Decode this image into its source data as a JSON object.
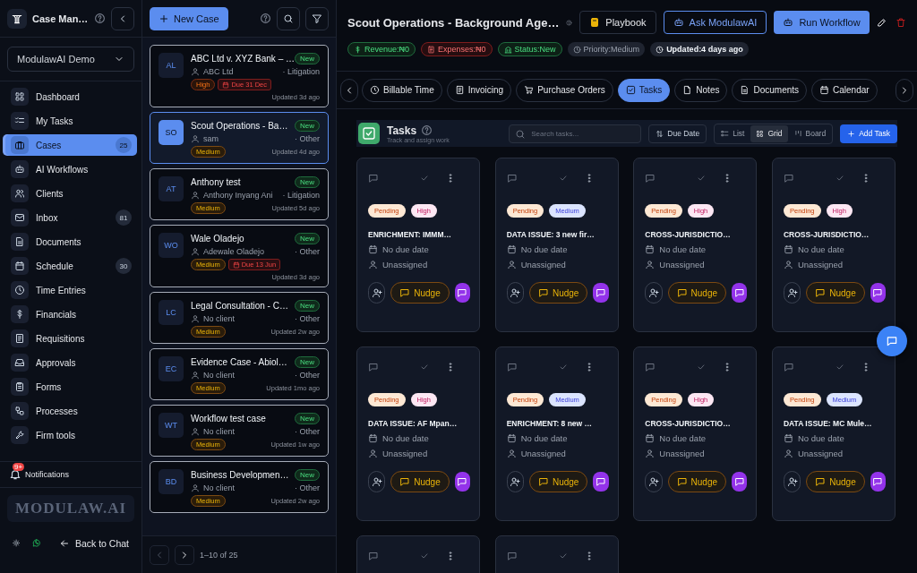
{
  "sidebar": {
    "title": "Case Man…",
    "workspace": "ModulawAI Demo",
    "items": [
      {
        "label": "Dashboard",
        "selected": false
      },
      {
        "label": "My Tasks",
        "selected": false
      },
      {
        "label": "Cases",
        "selected": true,
        "badge": "25"
      },
      {
        "label": "AI Workflows",
        "selected": false
      },
      {
        "label": "Clients",
        "selected": false
      },
      {
        "label": "Inbox",
        "selected": false,
        "badge": "81"
      },
      {
        "label": "Documents",
        "selected": false
      },
      {
        "label": "Schedule",
        "selected": false,
        "badge": "30"
      },
      {
        "label": "Time Entries",
        "selected": false
      },
      {
        "label": "Financials",
        "selected": false
      },
      {
        "label": "Requisitions",
        "selected": false
      },
      {
        "label": "Approvals",
        "selected": false
      },
      {
        "label": "Forms",
        "selected": false
      },
      {
        "label": "Processes",
        "selected": false
      },
      {
        "label": "Firm tools",
        "selected": false
      }
    ],
    "notifications": {
      "label": "Notifications",
      "badge": "9+"
    },
    "logo": "MODULAW.AI",
    "back": "Back to Chat"
  },
  "case_list": {
    "new_button": "New Case",
    "cases": [
      {
        "initials": "AL",
        "title": "ABC Ltd v. XYZ Bank – …",
        "status": "New",
        "client": "ABC Ltd",
        "type": "· Litigation",
        "priority": {
          "label": "High",
          "kind": "high"
        },
        "due": "Due 31 Dec",
        "updated": "Updated 3d ago",
        "selected": false
      },
      {
        "initials": "SO",
        "title": "Scout Operations - Ba…",
        "status": "New",
        "client": "sam",
        "type": "· Other",
        "priority": {
          "label": "Medium",
          "kind": "medium"
        },
        "updated": "Updated 4d ago",
        "selected": true
      },
      {
        "initials": "AT",
        "title": "Anthony test",
        "status": "New",
        "client": "Anthony Inyang Ani",
        "type": "· Litigation",
        "priority": {
          "label": "Medium",
          "kind": "medium"
        },
        "updated": "Updated 5d ago",
        "selected": false
      },
      {
        "initials": "WO",
        "title": "Wale Oladejo",
        "status": "New",
        "client": "Adewale Oladejo",
        "type": "· Other",
        "priority": {
          "label": "Medium",
          "kind": "medium"
        },
        "due": "Due 13 Jun",
        "updated": "Updated 3d ago",
        "selected": false
      },
      {
        "initials": "LC",
        "title": "Legal Consultation - C…",
        "status": "New",
        "client": "No client",
        "type": "· Other",
        "priority": {
          "label": "Medium",
          "kind": "medium"
        },
        "updated": "Updated 2w ago",
        "selected": false
      },
      {
        "initials": "EC",
        "title": "Evidence Case - Abiol…",
        "status": "New",
        "client": "No client",
        "type": "· Other",
        "priority": {
          "label": "Medium",
          "kind": "medium"
        },
        "updated": "Updated 1mo ago",
        "selected": false
      },
      {
        "initials": "WT",
        "title": "Workflow test case",
        "status": "New",
        "client": "No client",
        "type": "· Other",
        "priority": {
          "label": "Medium",
          "kind": "medium"
        },
        "updated": "Updated 1w ago",
        "selected": false
      },
      {
        "initials": "BD",
        "title": "Business Developmen…",
        "status": "New",
        "client": "No client",
        "type": "· Other",
        "priority": {
          "label": "Medium",
          "kind": "medium"
        },
        "updated": "Updated 2w ago",
        "selected": false
      }
    ],
    "pagination": "1–10 of 25"
  },
  "case": {
    "title": "Scout Operations - Background Age…",
    "actions": [
      {
        "label": "Playbook",
        "kind": "plain"
      },
      {
        "label": "Ask ModulawAI",
        "kind": "outline"
      },
      {
        "label": "Run Workflow",
        "kind": "primary"
      }
    ],
    "chips": [
      {
        "label": "Revenue:₦0",
        "kind": "revenue"
      },
      {
        "label": "Expenses:₦0",
        "kind": "expenses"
      },
      {
        "label": "Status:New",
        "kind": "status"
      },
      {
        "label": "Priority:Medium",
        "kind": "priority"
      },
      {
        "label": "Updated:4 days ago",
        "kind": "updated"
      }
    ]
  },
  "tabs": [
    {
      "label": "Billable Time",
      "selected": false
    },
    {
      "label": "Invoicing",
      "selected": false
    },
    {
      "label": "Purchase Orders",
      "selected": false
    },
    {
      "label": "Tasks",
      "selected": true
    },
    {
      "label": "Notes",
      "selected": false
    },
    {
      "label": "Documents",
      "selected": false
    },
    {
      "label": "Calendar",
      "selected": false
    }
  ],
  "tasks": {
    "title": "Tasks",
    "subtitle": "Track and assign work",
    "search_placeholder": "Search tasks...",
    "sort": "Due Date",
    "views": [
      {
        "label": "List",
        "selected": false
      },
      {
        "label": "Grid",
        "selected": true
      },
      {
        "label": "Board",
        "selected": false
      }
    ],
    "add": "Add Task",
    "cards": [
      {
        "kind": "full",
        "status": "Pending",
        "priority": {
          "label": "High",
          "kind": "high"
        },
        "title": "ENRICHMENT: IMMM…",
        "due": "No due date",
        "assignee": "Unassigned",
        "nudge": "Nudge"
      },
      {
        "kind": "full",
        "status": "Pending",
        "priority": {
          "label": "Medium",
          "kind": "medium"
        },
        "title": "DATA ISSUE: 3 new fir…",
        "due": "No due date",
        "assignee": "Unassigned",
        "nudge": "Nudge"
      },
      {
        "kind": "full",
        "status": "Pending",
        "priority": {
          "label": "High",
          "kind": "high"
        },
        "title": "CROSS-JURISDICTIO…",
        "due": "No due date",
        "assignee": "Unassigned",
        "nudge": "Nudge"
      },
      {
        "kind": "full",
        "status": "Pending",
        "priority": {
          "label": "High",
          "kind": "high"
        },
        "title": "CROSS-JURISDICTIO…",
        "due": "No due date",
        "assignee": "Unassigned",
        "nudge": "Nudge"
      },
      {
        "kind": "full",
        "status": "Pending",
        "priority": {
          "label": "High",
          "kind": "high"
        },
        "title": "DATA ISSUE: AF Mpan…",
        "due": "No due date",
        "assignee": "Unassigned",
        "nudge": "Nudge"
      },
      {
        "kind": "full",
        "status": "Pending",
        "priority": {
          "label": "Medium",
          "kind": "medium"
        },
        "title": "ENRICHMENT: 8 new …",
        "due": "No due date",
        "assignee": "Unassigned",
        "nudge": "Nudge"
      },
      {
        "kind": "full",
        "status": "Pending",
        "priority": {
          "label": "High",
          "kind": "high"
        },
        "title": "CROSS-JURISDICTIO…",
        "due": "No due date",
        "assignee": "Unassigned",
        "nudge": "Nudge"
      },
      {
        "kind": "full",
        "status": "Pending",
        "priority": {
          "label": "Medium",
          "kind": "medium"
        },
        "title": "DATA ISSUE: MC Mule…",
        "due": "No due date",
        "assignee": "Unassigned",
        "nudge": "Nudge"
      },
      {
        "kind": "stub"
      },
      {
        "kind": "stub"
      }
    ]
  }
}
